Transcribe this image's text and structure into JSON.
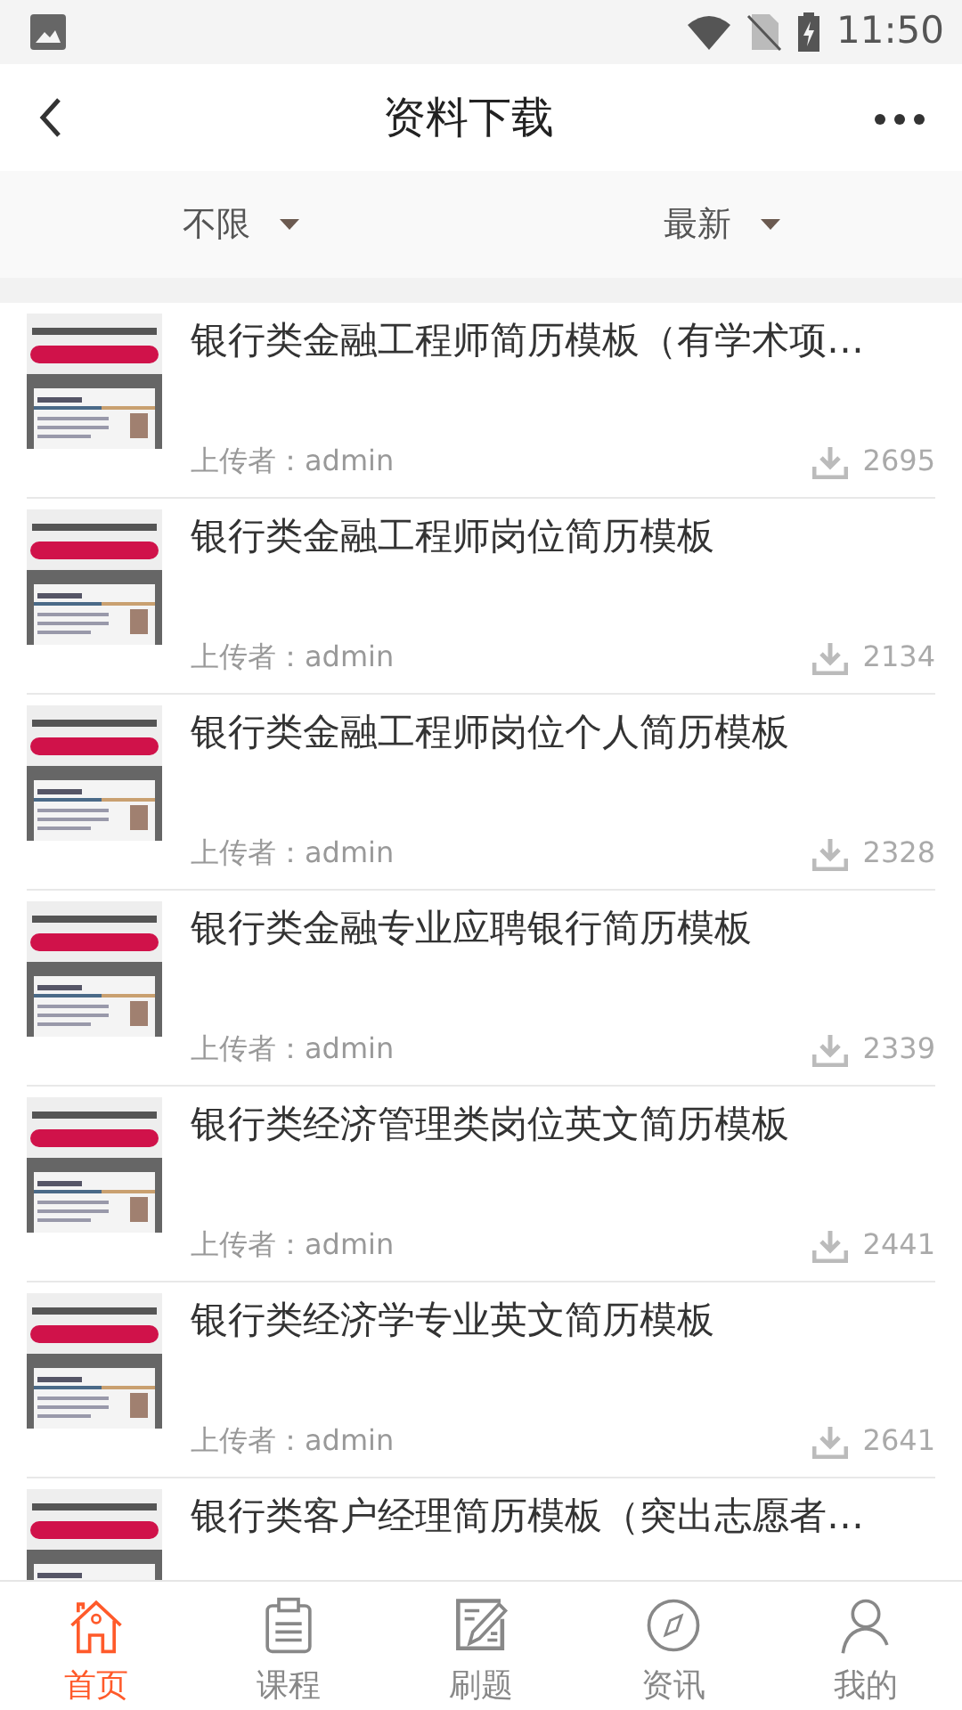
{
  "status_bar": {
    "time": "11:50"
  },
  "header": {
    "title": "资料下载"
  },
  "filters": [
    {
      "label": "不限"
    },
    {
      "label": "最新"
    }
  ],
  "items": [
    {
      "title": "银行类金融工程师简历模板（有学术项…",
      "uploader": "上传者：admin",
      "downloads": "2695"
    },
    {
      "title": "银行类金融工程师岗位简历模板",
      "uploader": "上传者：admin",
      "downloads": "2134"
    },
    {
      "title": "银行类金融工程师岗位个人简历模板",
      "uploader": "上传者：admin",
      "downloads": "2328"
    },
    {
      "title": "银行类金融专业应聘银行简历模板",
      "uploader": "上传者：admin",
      "downloads": "2339"
    },
    {
      "title": "银行类经济管理类岗位英文简历模板",
      "uploader": "上传者：admin",
      "downloads": "2441"
    },
    {
      "title": "银行类经济学专业英文简历模板",
      "uploader": "上传者：admin",
      "downloads": "2641"
    },
    {
      "title": "银行类客户经理简历模板（突出志愿者…"
    }
  ],
  "tabs": [
    {
      "kind": "home",
      "label": "首页",
      "selected": true
    },
    {
      "kind": "course",
      "label": "课程",
      "selected": false
    },
    {
      "kind": "practice",
      "label": "刷题",
      "selected": false
    },
    {
      "kind": "news",
      "label": "资讯",
      "selected": false
    },
    {
      "kind": "profile",
      "label": "我的",
      "selected": false
    }
  ]
}
